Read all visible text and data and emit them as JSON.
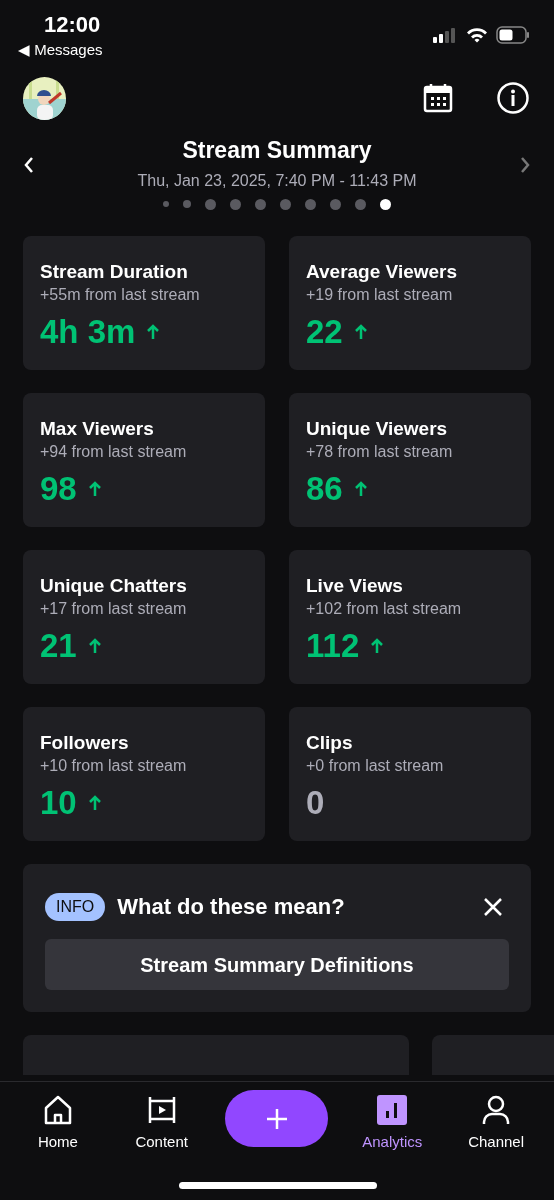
{
  "status_bar": {
    "time": "12:00",
    "back_label": "◀ Messages"
  },
  "header": {
    "title": "Stream Summary",
    "subtitle": "Thu, Jan 23, 2025, 7:40 PM - 11:43 PM"
  },
  "pager_dots": [
    {
      "kind": "tiny",
      "selected": false
    },
    {
      "kind": "small",
      "selected": false
    },
    {
      "kind": "normal",
      "selected": false
    },
    {
      "kind": "normal",
      "selected": false
    },
    {
      "kind": "normal",
      "selected": false
    },
    {
      "kind": "normal",
      "selected": false
    },
    {
      "kind": "normal",
      "selected": false
    },
    {
      "kind": "normal",
      "selected": false
    },
    {
      "kind": "normal",
      "selected": false
    },
    {
      "kind": "normal",
      "selected": true
    }
  ],
  "stats": [
    {
      "title": "Stream Duration",
      "change": "+55m from last stream",
      "value": "4h 3m",
      "kind": "increase"
    },
    {
      "title": "Average Viewers",
      "change": "+19 from last stream",
      "value": "22",
      "kind": "increase"
    },
    {
      "title": "Max Viewers",
      "change": "+94 from last stream",
      "value": "98",
      "kind": "increase"
    },
    {
      "title": "Unique Viewers",
      "change": "+78 from last stream",
      "value": "86",
      "kind": "increase"
    },
    {
      "title": "Unique Chatters",
      "change": "+17 from last stream",
      "value": "21",
      "kind": "increase"
    },
    {
      "title": "Live Views",
      "change": "+102 from last stream",
      "value": "112",
      "kind": "increase"
    },
    {
      "title": "Followers",
      "change": "+10 from last stream",
      "value": "10",
      "kind": "increase"
    },
    {
      "title": "Clips",
      "change": "+0 from last stream",
      "value": "0",
      "kind": "unchanged"
    }
  ],
  "info_card": {
    "badge": "INFO",
    "title": "What do these mean?",
    "button": "Stream Summary Definitions"
  },
  "tab_bar": [
    {
      "label": "Home",
      "kind": "home",
      "selected": false
    },
    {
      "label": "Content",
      "kind": "content",
      "selected": false
    },
    {
      "kind": "create"
    },
    {
      "label": "Analytics",
      "kind": "analytics",
      "selected": true
    },
    {
      "label": "Channel",
      "kind": "channel",
      "selected": false
    }
  ]
}
